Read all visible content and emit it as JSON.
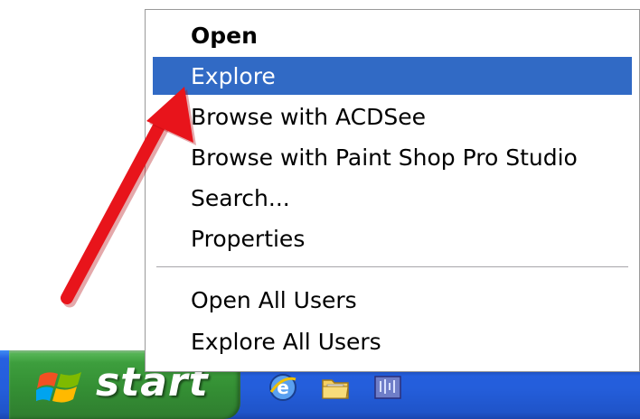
{
  "context_menu": {
    "items": [
      {
        "label": "Open"
      },
      {
        "label": "Explore"
      },
      {
        "label": "Browse with ACDSee"
      },
      {
        "label": "Browse with Paint Shop Pro Studio"
      },
      {
        "label": "Search..."
      },
      {
        "label": "Properties"
      },
      {
        "label": "Open All Users"
      },
      {
        "label": "Explore All Users"
      }
    ],
    "default_item": "Open",
    "selected_item": "Explore"
  },
  "taskbar": {
    "start_label": "start",
    "quick_launch_icons": [
      "internet-explorer-icon",
      "folder-icon",
      "media-player-icon"
    ],
    "overflow_chevron": "»"
  },
  "colors": {
    "selection_blue": "#316ac5",
    "taskbar_blue": "#245edb",
    "start_green": "#3d9e3d",
    "arrow_red": "#e8141b"
  }
}
